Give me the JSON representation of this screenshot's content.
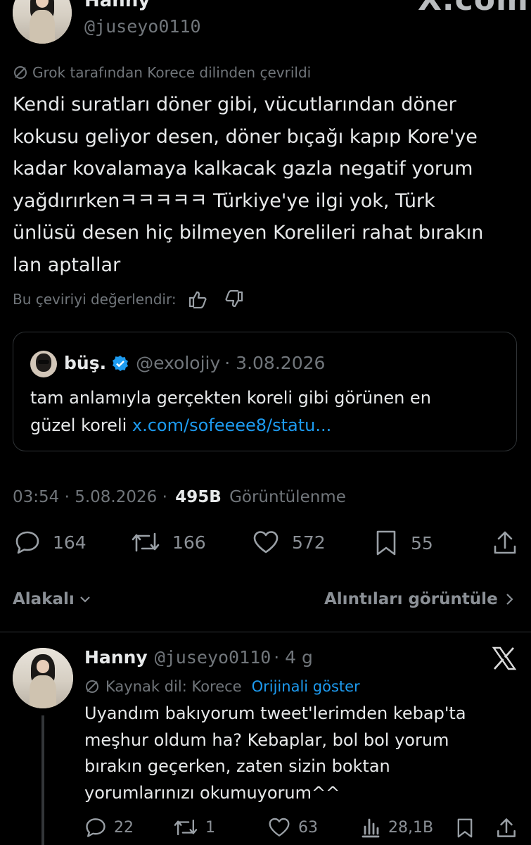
{
  "header": {
    "name": "Hanny",
    "handle": "@juseyo0110",
    "watermark": "X.com"
  },
  "main_tweet": {
    "translation_note": "Grok tarafından Korece dilinden çevrildi",
    "text_lines": [
      "Kendi suratları döner gibi, vücutlarından döner",
      "kokusu geliyor desen, döner bıçağı kapıp Kore'ye",
      "kadar kovalamaya kalkacak gazla negatif yorum",
      "yağdırırkenㅋㅋㅋㅋㅋ Türkiye'ye ilgi yok, Türk",
      "ünlüsü desen hiç bilmeyen Korelileri rahat bırakın",
      "lan aptallar"
    ],
    "rate_label": "Bu çeviriyi değerlendir:",
    "quote": {
      "name": "büş.",
      "handle": "@exolojiy",
      "date": "· 3.08.2026",
      "text_line1": "tam anlamıyla gerçekten koreli gibi görünen en",
      "text_line2_prefix": "güzel koreli ",
      "link": "x.com/sofeeee8/statu..."
    },
    "time": "03:54 · 5.08.2026 ·",
    "views_count": "495B",
    "views_label": "Görüntülenme",
    "actions": {
      "replies": "164",
      "retweets": "166",
      "likes": "572",
      "bookmarks": "55"
    }
  },
  "sort_bar": {
    "sort_label": "Alakalı",
    "quotes_link": "Alıntıları görüntüle"
  },
  "reply": {
    "name": "Hanny",
    "handle": "@juseyo0110",
    "time": "· 4 g",
    "source_note": "Kaynak dil: Korece",
    "show_original": "Orijinali göster",
    "text_lines": [
      "Uyandım bakıyorum tweet'lerimden kebap'ta",
      "meşhur oldum ha? Kebaplar, bol bol yorum",
      "bırakın geçerken, zaten sizin boktan",
      "yorumlarınızı okumuyorum^^"
    ],
    "actions": {
      "replies": "22",
      "retweets": "1",
      "likes": "63",
      "views": "28,1B"
    }
  },
  "colors": {
    "background": "#000000",
    "text": "#e7e9ea",
    "muted": "#71767b",
    "accent": "#1d9bf0"
  }
}
